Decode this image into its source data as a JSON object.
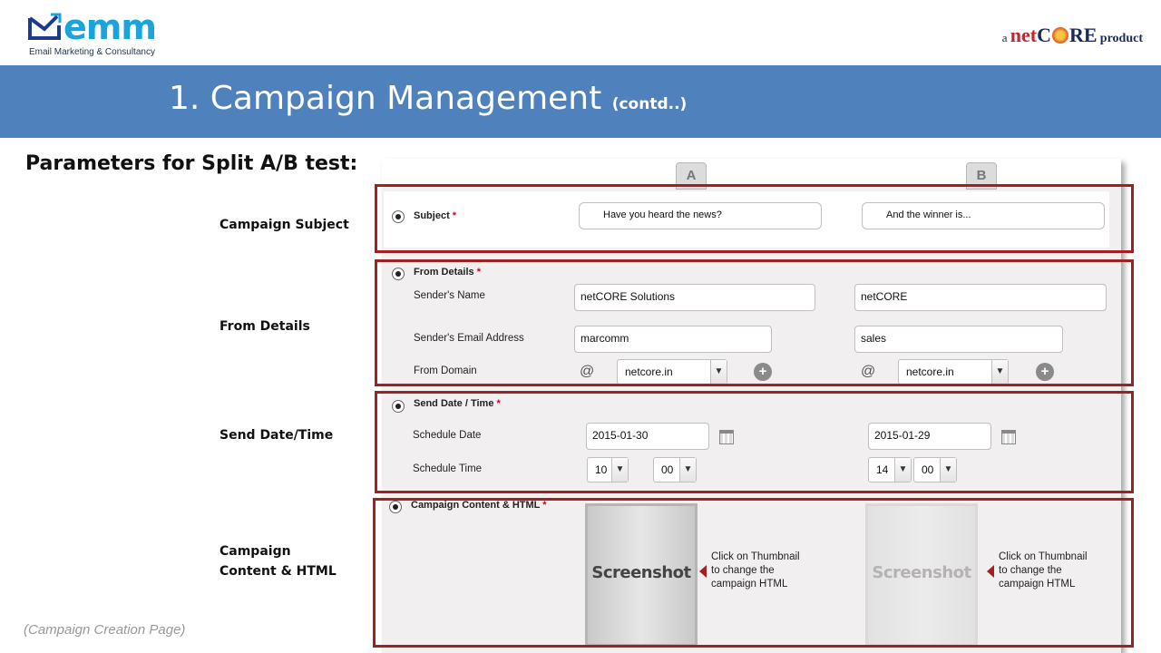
{
  "brand": {
    "logo_text": "emm",
    "tagline": "Email Marketing & Consultancy",
    "partner_prefix": "a",
    "partner_net": "net",
    "partner_c": "C",
    "partner_re": "RE",
    "partner_suffix": "product"
  },
  "header": {
    "title": "1. Campaign Management",
    "title_suffix": "(contd..)"
  },
  "slide": {
    "params_heading": "Parameters for Split A/B test:",
    "labels": {
      "subject": "Campaign Subject",
      "from": "From Details",
      "send": "Send Date/Time",
      "content_line1": "Campaign",
      "content_line2": "Content & HTML"
    },
    "caption": "(Campaign Creation Page)"
  },
  "form": {
    "col_a": "A",
    "col_b": "B",
    "subject": {
      "title": "Subject",
      "required": "*",
      "a_value": "Have you heard the news?",
      "b_value": "And the winner is..."
    },
    "from": {
      "title": "From Details",
      "required": "*",
      "sender_name_label": "Sender's Name",
      "sender_email_label": "Sender's Email Address",
      "domain_label": "From Domain",
      "a_name": "netCORE Solutions",
      "b_name": "netCORE",
      "a_email": "marcomm",
      "b_email": "sales",
      "at": "@",
      "a_domain": "netcore.in",
      "b_domain": "netcore.in",
      "plus": "+"
    },
    "send": {
      "title": "Send Date / Time",
      "required": "*",
      "date_label": "Schedule Date",
      "time_label": "Schedule Time",
      "a_date": "2015-01-30",
      "b_date": "2015-01-29",
      "a_hour": "10",
      "a_min": "00",
      "b_hour": "14",
      "b_min": "00"
    },
    "content": {
      "title": "Campaign Content & HTML",
      "required": "*",
      "thumb_label": "Screenshot",
      "note_line1": "Click on Thumbnail",
      "note_line2": "to change the",
      "note_line3": "campaign HTML"
    }
  },
  "colors": {
    "title_bar": "#4f81bd",
    "highlight_border": "#a31f24",
    "logo_blue": "#1aa3dc"
  }
}
